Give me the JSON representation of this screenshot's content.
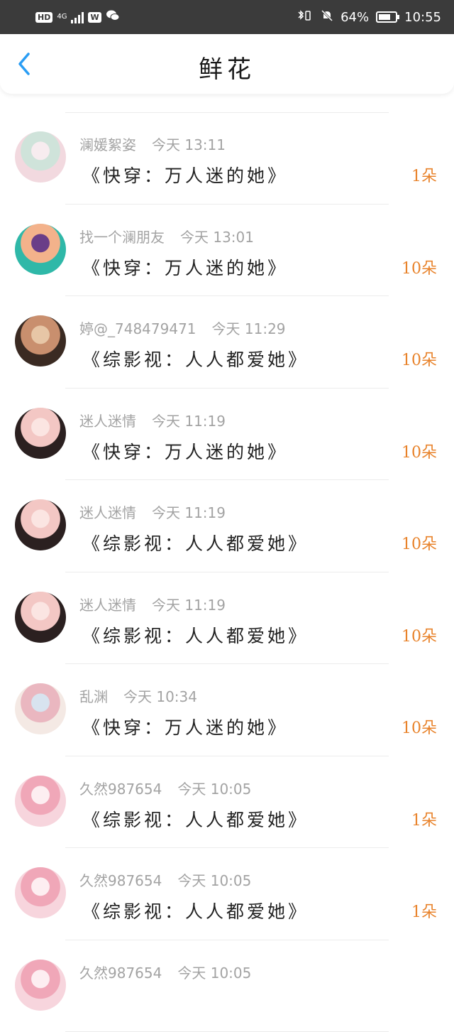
{
  "status_bar": {
    "hd": "HD",
    "network": "4G",
    "app_w": "W",
    "battery_percent": "64%",
    "time": "10:55"
  },
  "header": {
    "title": "鲜花"
  },
  "rows": [
    {
      "user": "澜媛絮姿",
      "time": "今天 13:11",
      "book": "《快穿：万人迷的她》",
      "amount": "1朵",
      "avatar_colors": [
        "#f2d9df",
        "#cfe3da",
        "#f7ecef"
      ]
    },
    {
      "user": "找一个澜朋友",
      "time": "今天 13:01",
      "book": "《快穿：万人迷的她》",
      "amount": "10朵",
      "avatar_colors": [
        "#2fb8a8",
        "#f3b28b",
        "#6a3d88"
      ]
    },
    {
      "user": "婷@_748479471",
      "time": "今天 11:29",
      "book": "《综影视：人人都爱她》",
      "amount": "10朵",
      "avatar_colors": [
        "#3a2a22",
        "#c98f6e",
        "#e7c6a6"
      ]
    },
    {
      "user": "迷人迷情",
      "time": "今天 11:19",
      "book": "《快穿：万人迷的她》",
      "amount": "10朵",
      "avatar_colors": [
        "#2b2020",
        "#f3c7c4",
        "#fbe5e2"
      ]
    },
    {
      "user": "迷人迷情",
      "time": "今天 11:19",
      "book": "《综影视：人人都爱她》",
      "amount": "10朵",
      "avatar_colors": [
        "#2b2020",
        "#f3c7c4",
        "#fbe5e2"
      ]
    },
    {
      "user": "迷人迷情",
      "time": "今天 11:19",
      "book": "《综影视：人人都爱她》",
      "amount": "10朵",
      "avatar_colors": [
        "#2b2020",
        "#f3c7c4",
        "#fbe5e2"
      ]
    },
    {
      "user": "乱渊",
      "time": "今天 10:34",
      "book": "《快穿：万人迷的她》",
      "amount": "10朵",
      "avatar_colors": [
        "#f4e9e4",
        "#eab7c0",
        "#d8e3ef"
      ]
    },
    {
      "user": "久然987654",
      "time": "今天 10:05",
      "book": "《综影视：人人都爱她》",
      "amount": "1朵",
      "avatar_colors": [
        "#f7d5dd",
        "#f0a7b8",
        "#fdeef1"
      ]
    },
    {
      "user": "久然987654",
      "time": "今天 10:05",
      "book": "《综影视：人人都爱她》",
      "amount": "1朵",
      "avatar_colors": [
        "#f7d5dd",
        "#f0a7b8",
        "#fdeef1"
      ]
    },
    {
      "user": "久然987654",
      "time": "今天 10:05",
      "book": "",
      "amount": "",
      "avatar_colors": [
        "#f7d5dd",
        "#f0a7b8",
        "#fdeef1"
      ]
    }
  ]
}
